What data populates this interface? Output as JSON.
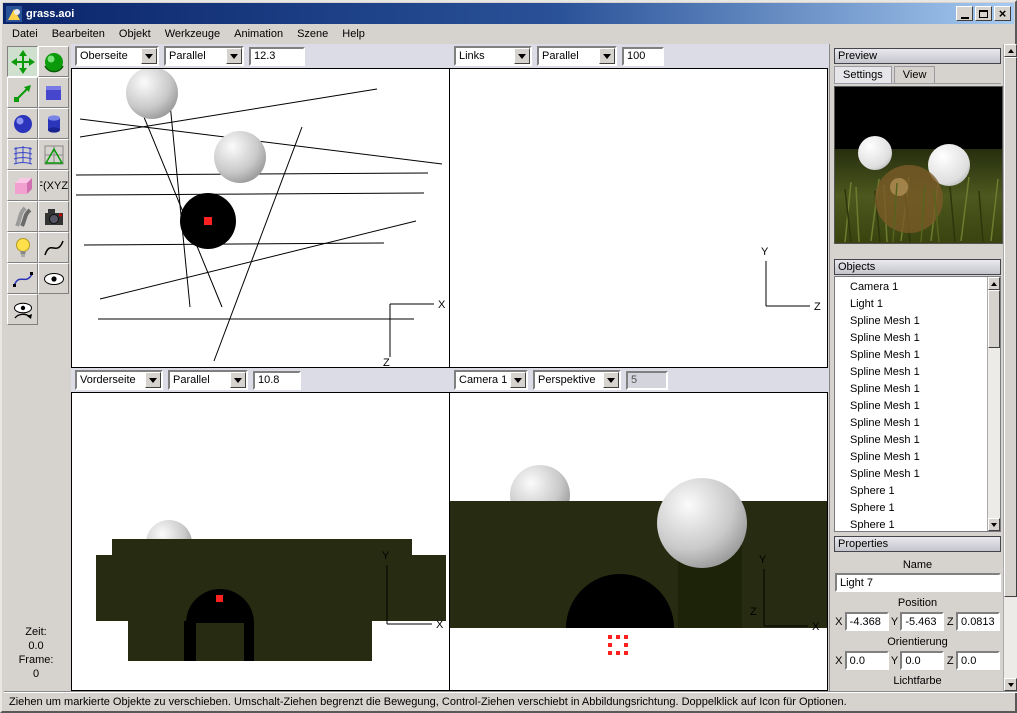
{
  "window": {
    "title": "grass.aoi"
  },
  "menu": {
    "items": [
      "Datei",
      "Bearbeiten",
      "Objekt",
      "Werkzeuge",
      "Animation",
      "Szene",
      "Help"
    ]
  },
  "toolbar": {
    "tools": [
      "move",
      "rotate",
      "scale",
      "box",
      "sphere",
      "cylinder",
      "spline-mesh",
      "triangle-mesh",
      "cube",
      "function-fxyz",
      "tube",
      "camera",
      "light",
      "curve",
      "spline-curve",
      "pan-view",
      "rotate-view"
    ],
    "fxyz_label": "F(XYZ)"
  },
  "viewports": {
    "top_left": {
      "view": "Oberseite",
      "projection": "Parallel",
      "scale": "12.3",
      "axis_h": "X",
      "axis_v": "Z"
    },
    "top_right": {
      "view": "Links",
      "projection": "Parallel",
      "scale": "100",
      "axis_v": "Y",
      "axis_h": "Z"
    },
    "bottom_left": {
      "view": "Vorderseite",
      "projection": "Parallel",
      "scale": "10.8",
      "axis_v": "Y",
      "axis_h": "X"
    },
    "bottom_right": {
      "view": "Camera 1",
      "projection": "Perspektive",
      "scale": "5",
      "axis_v": "Y",
      "axis_h": "X",
      "axis_d": "Z"
    }
  },
  "preview": {
    "title": "Preview",
    "tabs": [
      "Settings",
      "View"
    ]
  },
  "objects": {
    "title": "Objects",
    "items": [
      "Camera 1",
      "Light 1",
      "Spline Mesh 1",
      "Spline Mesh 1",
      "Spline Mesh 1",
      "Spline Mesh 1",
      "Spline Mesh 1",
      "Spline Mesh 1",
      "Spline Mesh 1",
      "Spline Mesh 1",
      "Spline Mesh 1",
      "Spline Mesh 1",
      "Sphere 1",
      "Sphere 1",
      "Sphere 1"
    ]
  },
  "properties": {
    "title": "Properties",
    "name_label": "Name",
    "name_value": "Light 7",
    "position_label": "Position",
    "position": {
      "x": "-4.368",
      "y": "-5.463",
      "z": "0.0813"
    },
    "orientation_label": "Orientierung",
    "orientation": {
      "x": "0.0",
      "y": "0.0",
      "z": "0.0"
    },
    "light_color_label": "Lichtfarbe",
    "axis_labels": [
      "X",
      "Y",
      "Z"
    ]
  },
  "timeline": {
    "time_label": "Zeit:",
    "time_value": "0.0",
    "frame_label": "Frame:",
    "frame_value": "0"
  },
  "statusbar": {
    "text": "Ziehen um markierte Objekte zu verschieben. Umschalt-Ziehen begrenzt die Bewegung, Control-Ziehen verschiebt in Abbildungsrichtung. Doppelklick auf Icon für Optionen."
  },
  "colors": {
    "titlebar_left": "#0a246a",
    "titlebar_right": "#a6caf0",
    "scene_green": "#272b11",
    "selection_red": "#ff2020",
    "chrome": "#d6d3ce"
  }
}
